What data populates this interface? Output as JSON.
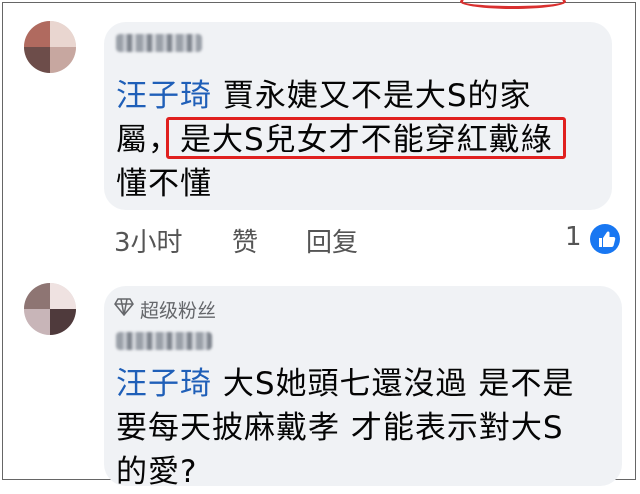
{
  "comments": [
    {
      "mention": "汪子琦",
      "line1_rest": "賈永婕又不是大S的家",
      "line2_pre": "屬，",
      "line2_highlight": "是大S兒女才不能穿紅戴綠",
      "line3": "懂不懂",
      "actions": {
        "time": "3小时",
        "like": "赞",
        "reply": "回复"
      },
      "reaction_count": "1",
      "reaction_icon": "thumbs-up-icon"
    },
    {
      "badge_label": "超级粉丝",
      "badge_icon": "diamond-icon",
      "mention": "汪子琦",
      "line1_rest": "大S她頭七還沒過 是不是",
      "line2": "要每天披麻戴孝 才能表示對大S",
      "line3": "的愛?"
    }
  ],
  "colors": {
    "highlight_box": "#e0201f",
    "mention": "#1f5fb8",
    "bubble_bg": "#f0f2f5",
    "like_blue": "#1877f2"
  }
}
